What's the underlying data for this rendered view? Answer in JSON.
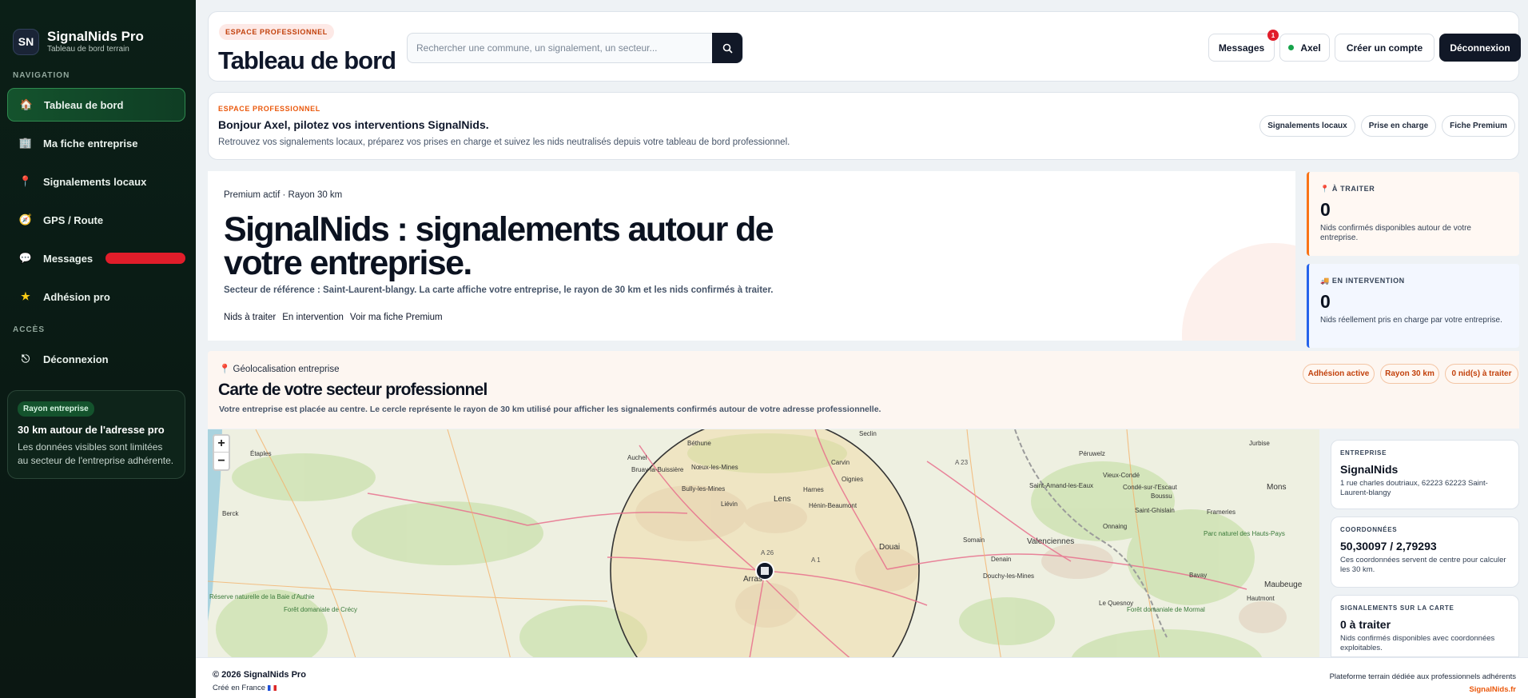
{
  "sidebar": {
    "logo": "SN",
    "brand_name": "SignalNids Pro",
    "brand_sub": "Tableau de bord terrain",
    "nav_title": "Navigation",
    "items": [
      {
        "label": "Tableau de bord",
        "icon": "house-icon"
      },
      {
        "label": "Ma fiche entreprise",
        "icon": "building-icon"
      },
      {
        "label": "Signalements locaux",
        "icon": "map-pin-icon"
      },
      {
        "label": "GPS / Route",
        "icon": "compass-icon"
      },
      {
        "label": "Messages",
        "icon": "chat-icon"
      },
      {
        "label": "Adhésion pro",
        "icon": "star-icon"
      }
    ],
    "access_title": "Accès",
    "logout_label": "Déconnexion",
    "rayon_card": {
      "badge": "Rayon entreprise",
      "title": "30 km autour de l'adresse pro",
      "text": "Les données visibles sont limitées au secteur de l'entreprise adhérente."
    }
  },
  "topbar": {
    "tag": "Espace professionnel",
    "title": "Tableau de bord",
    "search_placeholder": "Rechercher une commune, un signalement, un secteur...",
    "messages_label": "Messages",
    "messages_count": "1",
    "user_name": "Axel",
    "create_account": "Créer un compte",
    "logout": "Déconnexion"
  },
  "welcome": {
    "tag": "Espace professionnel",
    "title": "Bonjour Axel, pilotez vos interventions SignalNids.",
    "text": "Retrouvez vos signalements locaux, préparez vos prises en charge et suivez les nids neutralisés depuis votre tableau de bord professionnel.",
    "chips": [
      "Signalements locaux",
      "Prise en charge",
      "Fiche Premium"
    ]
  },
  "hero": {
    "kicker": "Premium actif · Rayon 30 km",
    "title": "SignalNids : signalements autour de votre entreprise.",
    "subtitle": "Secteur de référence : Saint-Laurent-blangy. La carte affiche votre entreprise, le rayon de 30 km et les nids confirmés à traiter.",
    "links": [
      "Nids à traiter",
      "En intervention",
      "Voir ma fiche Premium"
    ]
  },
  "stats": [
    {
      "label": "À traiter",
      "value": "0",
      "text": "Nids confirmés disponibles autour de votre entreprise.",
      "accent": "#f97316"
    },
    {
      "label": "En intervention",
      "value": "0",
      "text": "Nids réellement pris en charge par votre entreprise.",
      "accent": "#2563eb"
    }
  ],
  "geo": {
    "kicker": "Géolocalisation entreprise",
    "title": "Carte de votre secteur professionnel",
    "text": "Votre entreprise est placée au centre. Le cercle représente le rayon de 30 km utilisé pour afficher les signalements confirmés autour de votre adresse professionnelle.",
    "chips": [
      "Adhésion active",
      "Rayon 30 km",
      "0 nid(s) à traiter"
    ]
  },
  "map": {
    "zoom_in": "+",
    "zoom_out": "−",
    "places": [
      "Béthune",
      "Auchel",
      "Bruay-la-Buissière",
      "Nœux-les-Mines",
      "Bully-les-Mines",
      "Liévin",
      "Lens",
      "Harnes",
      "Carvin",
      "Hénin-Beaumont",
      "Oignies",
      "Douai",
      "Arras",
      "Étaples",
      "Berck",
      "Seclin",
      "Péruwelz",
      "Saint-Amand-les-Eaux",
      "Vieux-Condé",
      "Condé-sur-l'Escaut",
      "Valenciennes",
      "Denain",
      "Onnaing",
      "Saint-Ghislain",
      "Boussu",
      "Frameries",
      "Mons",
      "Jurbise",
      "Bavay",
      "Maubeuge",
      "Hautmont",
      "Le Quesnoy",
      "Douchy-les-Mines",
      "Somain",
      "Parc naturel des Hauts-Pays"
    ],
    "roads": [
      "A 23",
      "A 26",
      "A 1"
    ],
    "forest_labels": [
      "Forêt domaniale de Crécy",
      "Forêt domaniale de Mormal"
    ],
    "coast_label": "Réserve naturelle de la Baie d'Authie"
  },
  "side": {
    "company": {
      "label": "Entreprise",
      "name": "SignalNids",
      "address": "1 rue charles doutriaux, 62223 62223 Saint-Laurent-blangy"
    },
    "coords": {
      "label": "Coordonnées",
      "value": "50,30097 / 2,79293",
      "text": "Ces coordonnées servent de centre pour calculer les 30 km."
    },
    "reports": {
      "label": "Signalements sur la carte",
      "value": "0 à traiter",
      "text": "Nids confirmés disponibles avec coordonnées exploitables."
    }
  },
  "footer": {
    "copyright": "© 2026 SignalNids Pro",
    "made_in": "Créé en France",
    "tagline": "Plateforme terrain dédiée aux professionnels adhérents",
    "site": "SignalNids.fr"
  }
}
